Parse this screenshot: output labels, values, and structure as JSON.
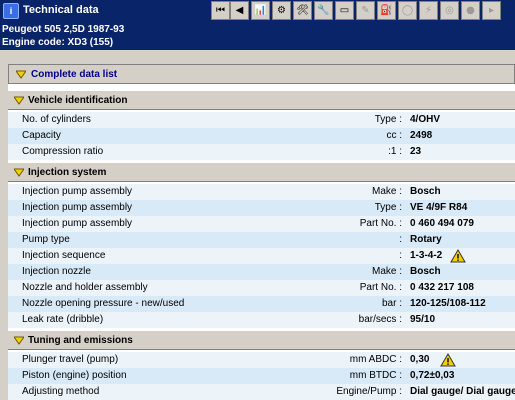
{
  "window": {
    "title": "Technical data",
    "app_icon": "app-icon"
  },
  "toolbar": {
    "buttons": [
      {
        "name": "first-record-icon",
        "glyph": "⏮"
      },
      {
        "name": "prev-record-icon",
        "glyph": "◀"
      },
      {
        "name": "chart-icon",
        "glyph": "📊"
      },
      {
        "name": "settings-icon",
        "glyph": "⚙"
      },
      {
        "name": "engine-icon",
        "glyph": "🛠"
      },
      {
        "name": "diagnostic-icon",
        "glyph": "🔧"
      },
      {
        "name": "battery-icon",
        "glyph": "▭"
      },
      {
        "name": "brush-icon",
        "glyph": "✎"
      },
      {
        "name": "filter-icon",
        "glyph": "⛽"
      },
      {
        "name": "belt-icon",
        "glyph": "◯"
      },
      {
        "name": "spark-icon",
        "glyph": "⚡"
      },
      {
        "name": "tyre-icon",
        "glyph": "◎"
      },
      {
        "name": "light-icon",
        "glyph": "●"
      },
      {
        "name": "more-icon",
        "glyph": "▸"
      }
    ]
  },
  "vehicle": {
    "line1": "Peugeot   505  2,5D  1987-93",
    "line2": "Engine code: XD3 (155)"
  },
  "list": {
    "complete_label": "Complete data list",
    "sections": {
      "vehicle_id": {
        "title": "Vehicle identification",
        "rows": [
          {
            "label": "No. of cylinders",
            "unit": "Type :",
            "value": "4/OHV"
          },
          {
            "label": "Capacity",
            "unit": "cc :",
            "value": "2498"
          },
          {
            "label": "Compression ratio",
            "unit": ":1 :",
            "value": "23"
          }
        ]
      },
      "injection": {
        "title": "Injection system",
        "rows": [
          {
            "label": "Injection pump assembly",
            "unit": "Make :",
            "value": "Bosch"
          },
          {
            "label": "Injection pump assembly",
            "unit": "Type :",
            "value": "VE 4/9F R84"
          },
          {
            "label": "Injection pump assembly",
            "unit": "Part No. :",
            "value": "0 460 494 079"
          },
          {
            "label": "Pump type",
            "unit": ":",
            "value": "Rotary"
          },
          {
            "label": "Injection sequence",
            "unit": ":",
            "value": "1-3-4-2"
          },
          {
            "label": "Injection nozzle",
            "unit": "Make :",
            "value": "Bosch"
          },
          {
            "label": "Nozzle and holder assembly",
            "unit": "Part No. :",
            "value": "0 432 217 108"
          },
          {
            "label": "Nozzle opening pressure - new/used",
            "unit": "bar :",
            "value": "120-125/108-112"
          },
          {
            "label": "Leak rate (dribble)",
            "unit": "bar/secs :",
            "value": "95/10"
          }
        ]
      },
      "tuning": {
        "title": "Tuning and emissions",
        "rows": [
          {
            "label": "Plunger travel (pump)",
            "unit": "mm ABDC :",
            "value": "0,30"
          },
          {
            "label": "Piston (engine) position",
            "unit": "mm BTDC :",
            "value": "0,72±0,03"
          },
          {
            "label": "Adjusting method",
            "unit": "Engine/Pump :",
            "value": "Dial gauge/ Dial gauge"
          }
        ]
      }
    }
  },
  "colors": {
    "title_bar": "#0a246a",
    "section_bg": "#d4d0c8",
    "row_light": "#ecf4fa",
    "row_dark": "#d8eaf8",
    "diamond": "#f5d000",
    "warning": "#f5d000"
  }
}
